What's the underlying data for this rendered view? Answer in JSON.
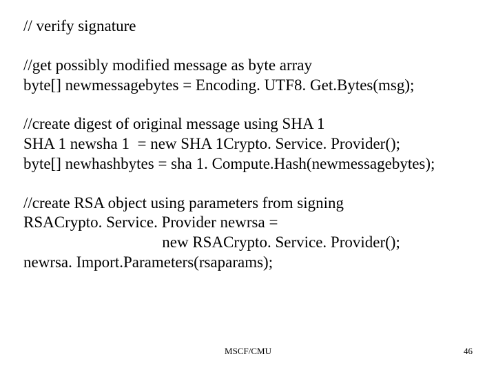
{
  "content": {
    "p1": "// verify signature",
    "p2": "//get possibly modified message as byte array\nbyte[] newmessagebytes = Encoding. UTF8. Get.Bytes(msg);",
    "p3": "//create digest of original message using SHA 1\nSHA 1 newsha 1  = new SHA 1Crypto. Service. Provider();\nbyte[] newhashbytes = sha 1. Compute.Hash(newmessagebytes);",
    "p4": "//create RSA object using parameters from signing\nRSACrypto. Service. Provider newrsa =\n                                   new RSACrypto. Service. Provider();\nnewrsa. Import.Parameters(rsaparams);"
  },
  "footer": {
    "center": "MSCF/CMU",
    "page": "46"
  }
}
